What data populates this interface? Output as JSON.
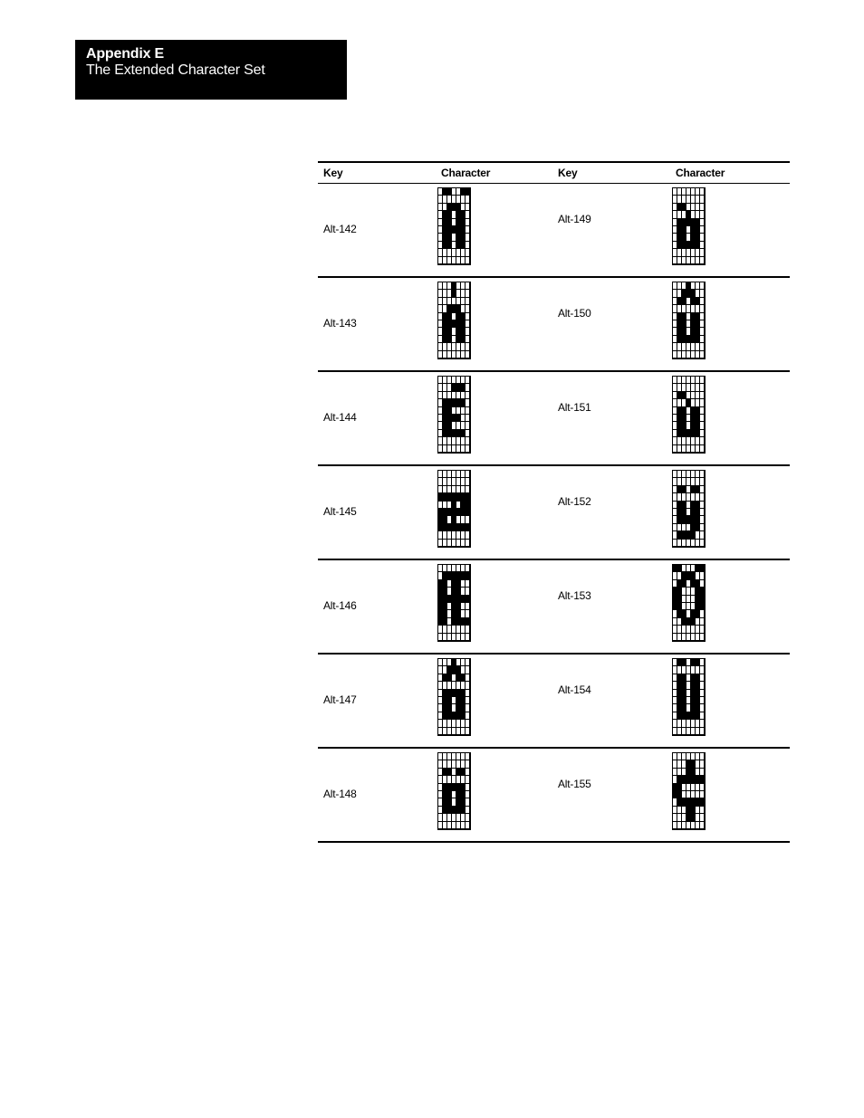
{
  "header": {
    "appendix": "Appendix E",
    "title": "The Extended Character Set"
  },
  "table": {
    "columns": [
      "Key",
      "Character",
      "Key",
      "Character"
    ],
    "rows": [
      {
        "left": {
          "key": "Alt-142",
          "char": "Ä",
          "pattern": [
            "0110011",
            "0000000",
            "0011100",
            "0110110",
            "0110110",
            "0111110",
            "0110110",
            "0110110",
            "0000000",
            "0000000"
          ]
        },
        "right": {
          "key": "Alt-149",
          "char": "ò",
          "pattern": [
            "0000000",
            "0000000",
            "0110000",
            "0001000",
            "0111110",
            "0110110",
            "0110110",
            "0111110",
            "0000000",
            "0000000"
          ]
        }
      },
      {
        "left": {
          "key": "Alt-143",
          "char": "Å",
          "pattern": [
            "0001000",
            "0001000",
            "0000000",
            "0011100",
            "0110110",
            "0111110",
            "0110110",
            "0110110",
            "0000000",
            "0000000"
          ]
        },
        "right": {
          "key": "Alt-150",
          "char": "û",
          "pattern": [
            "0001000",
            "0011100",
            "0110110",
            "0000000",
            "0110110",
            "0110110",
            "0110110",
            "0111110",
            "0000000",
            "0000000"
          ]
        }
      },
      {
        "left": {
          "key": "Alt-144",
          "char": "É",
          "pattern": [
            "0000000",
            "0001110",
            "0000000",
            "0111110",
            "0110000",
            "0111100",
            "0110000",
            "0111110",
            "0000000",
            "0000000"
          ]
        },
        "right": {
          "key": "Alt-151",
          "char": "ù",
          "pattern": [
            "0000000",
            "0000000",
            "0110000",
            "0001000",
            "0110110",
            "0110110",
            "0110110",
            "0111110",
            "0000000",
            "0000000"
          ]
        }
      },
      {
        "left": {
          "key": "Alt-145",
          "char": "æ",
          "pattern": [
            "0000000",
            "0000000",
            "0000000",
            "1111111",
            "0001011",
            "1111111",
            "1101000",
            "1111111",
            "0000000",
            "0000000"
          ]
        },
        "right": {
          "key": "Alt-152",
          "char": "ÿ",
          "pattern": [
            "0000000",
            "0000000",
            "0110110",
            "0000000",
            "0110110",
            "0110110",
            "0111110",
            "0000110",
            "0111100",
            "0000000"
          ]
        }
      },
      {
        "left": {
          "key": "Alt-146",
          "char": "Æ",
          "pattern": [
            "0000000",
            "0111111",
            "1101100",
            "1101100",
            "1111111",
            "1101100",
            "1101100",
            "1101111",
            "0000000",
            "0000000"
          ]
        },
        "right": {
          "key": "Alt-153",
          "char": "Ö",
          "pattern": [
            "1100011",
            "0011100",
            "0110110",
            "1100011",
            "1100011",
            "1100011",
            "0110110",
            "0011100",
            "0000000",
            "0000000"
          ]
        }
      },
      {
        "left": {
          "key": "Alt-147",
          "char": "ô",
          "pattern": [
            "0001000",
            "0011100",
            "0110110",
            "0000000",
            "0111110",
            "0110110",
            "0110110",
            "0111110",
            "0000000",
            "0000000"
          ]
        },
        "right": {
          "key": "Alt-154",
          "char": "Ü",
          "pattern": [
            "0110110",
            "0000000",
            "0110110",
            "0110110",
            "0110110",
            "0110110",
            "0110110",
            "0111110",
            "0000000",
            "0000000"
          ]
        }
      },
      {
        "left": {
          "key": "Alt-148",
          "char": "ö",
          "pattern": [
            "0000000",
            "0000000",
            "0110110",
            "0000000",
            "0111110",
            "0110110",
            "0110110",
            "0111110",
            "0000000",
            "0000000"
          ]
        },
        "right": {
          "key": "Alt-155",
          "char": "¢",
          "pattern": [
            "0000000",
            "0001100",
            "0001100",
            "0111111",
            "1100000",
            "1100000",
            "0111111",
            "0001100",
            "0001100",
            "0000000"
          ]
        }
      }
    ]
  }
}
